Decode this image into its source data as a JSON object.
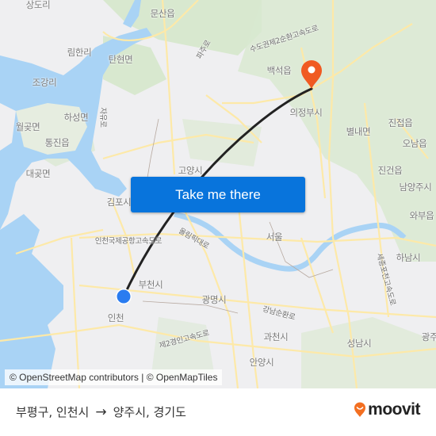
{
  "map": {
    "cta_label": "Take me there",
    "attribution": "© OpenStreetMap contributors | © OpenMapTiles",
    "origin_marker": "origin-dot",
    "destination_marker": "destination-pin",
    "colors": {
      "land": "#efeff1",
      "water": "#a9d3f5",
      "park": "#d6e7cc",
      "road": "#fde9a8",
      "route_line": "#222222",
      "origin": "#2a7cf0",
      "destination": "#f05a22",
      "cta": "#0874dc"
    },
    "places": [
      {
        "name": "상도리",
        "kind": "place"
      },
      {
        "name": "문산읍",
        "kind": "place"
      },
      {
        "name": "림한리",
        "kind": "place"
      },
      {
        "name": "탄현면",
        "kind": "place"
      },
      {
        "name": "조강리",
        "kind": "place"
      },
      {
        "name": "하성면",
        "kind": "place"
      },
      {
        "name": "월곶면",
        "kind": "place"
      },
      {
        "name": "통진읍",
        "kind": "place"
      },
      {
        "name": "대곶면",
        "kind": "place"
      },
      {
        "name": "고양시",
        "kind": "place"
      },
      {
        "name": "김포시",
        "kind": "place"
      },
      {
        "name": "백석읍",
        "kind": "place"
      },
      {
        "name": "의정부시",
        "kind": "place"
      },
      {
        "name": "별내면",
        "kind": "place"
      },
      {
        "name": "진접읍",
        "kind": "place"
      },
      {
        "name": "오남읍",
        "kind": "place"
      },
      {
        "name": "진건읍",
        "kind": "place"
      },
      {
        "name": "남양주시",
        "kind": "place"
      },
      {
        "name": "와부읍",
        "kind": "place"
      },
      {
        "name": "서울",
        "kind": "place"
      },
      {
        "name": "하남시",
        "kind": "place"
      },
      {
        "name": "부천시",
        "kind": "place"
      },
      {
        "name": "광명시",
        "kind": "place"
      },
      {
        "name": "인천",
        "kind": "place"
      },
      {
        "name": "과천시",
        "kind": "place"
      },
      {
        "name": "성남시",
        "kind": "place"
      },
      {
        "name": "안양시",
        "kind": "place"
      },
      {
        "name": "광주",
        "kind": "place"
      },
      {
        "name": "자유로",
        "kind": "road"
      },
      {
        "name": "파주로",
        "kind": "road"
      },
      {
        "name": "수도권제2순환고속도로",
        "kind": "road"
      },
      {
        "name": "인천국제공항고속도로",
        "kind": "road"
      },
      {
        "name": "올림픽대로",
        "kind": "road"
      },
      {
        "name": "강남순환로",
        "kind": "road"
      },
      {
        "name": "제2경인고속도로",
        "kind": "road"
      },
      {
        "name": "세종포천고속도로",
        "kind": "road"
      }
    ]
  },
  "footer": {
    "origin": "부평구, 인천시",
    "arrow": "→",
    "destination": "양주시, 경기도",
    "brand": "moovit"
  }
}
